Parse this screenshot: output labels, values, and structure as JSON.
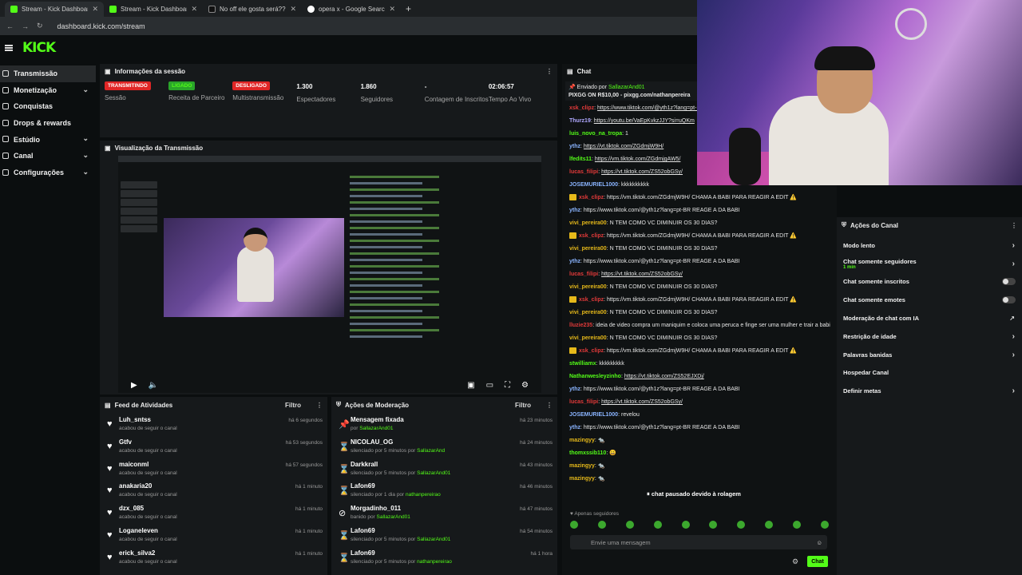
{
  "browser": {
    "tabs": [
      {
        "label": "Stream - Kick Dashboard",
        "active": true
      },
      {
        "label": "Stream - Kick Dashboard",
        "active": false
      },
      {
        "label": "No off ele gosta será?? 😂😂 |",
        "active": false
      },
      {
        "label": "opera x - Google Search",
        "active": false
      }
    ],
    "url": "dashboard.kick.com/stream"
  },
  "app": {
    "logo": "KICK"
  },
  "sidebar": {
    "items": [
      {
        "label": "Transmissão",
        "active": true
      },
      {
        "label": "Monetização"
      },
      {
        "label": "Conquistas"
      },
      {
        "label": "Drops & rewards"
      },
      {
        "label": "Estúdio"
      },
      {
        "label": "Canal"
      },
      {
        "label": "Configurações"
      }
    ]
  },
  "session": {
    "title": "Informações da sessão",
    "stats": [
      {
        "badge": "TRANSMITINDO",
        "label": "Sessão"
      },
      {
        "badge": "LIGADO",
        "label": "Receita de Parceiro"
      },
      {
        "badge": "DESLIGADO",
        "label": "Multistransmissão"
      },
      {
        "value": "1.300",
        "label": "Espectadores"
      },
      {
        "value": "1.860",
        "label": "Seguidores"
      },
      {
        "value": "-",
        "label": "Contagem de Inscritos"
      },
      {
        "value": "02:06:57",
        "label": "Tempo Ao Vivo"
      }
    ]
  },
  "preview": {
    "title": "Visualização da Transmissão"
  },
  "feed": {
    "title": "Feed de Atividades",
    "filter": "Filtro",
    "items": [
      {
        "name": "Luh_sntss",
        "action": "acabou de seguir o canal",
        "time": "há 6 segundos"
      },
      {
        "name": "Gtfv",
        "action": "acabou de seguir o canal",
        "time": "há 53 segundos"
      },
      {
        "name": "maiconml",
        "action": "acabou de seguir o canal",
        "time": "há 57 segundos"
      },
      {
        "name": "anakaria20",
        "action": "acabou de seguir o canal",
        "time": "há 1 minuto"
      },
      {
        "name": "dzx_085",
        "action": "acabou de seguir o canal",
        "time": "há 1 minuto"
      },
      {
        "name": "Loganeleven",
        "action": "acabou de seguir o canal",
        "time": "há 1 minuto"
      },
      {
        "name": "erick_silva2",
        "action": "acabou de seguir o canal",
        "time": "há 1 minuto"
      }
    ]
  },
  "moderation": {
    "title": "Ações de Moderação",
    "filter": "Filtro",
    "items": [
      {
        "name": "Mensagem fixada",
        "prefix": "por",
        "by": "SallazarAnd01",
        "time": "há 23 minutos"
      },
      {
        "name": "NICOLAU_OG",
        "prefix": "silenciado por 5 minutos por",
        "by": "SallazarAnd",
        "time": "há 24 minutos"
      },
      {
        "name": "Darkkrall",
        "prefix": "silenciado por 5 minutos por",
        "by": "SallazarAnd01",
        "time": "há 43 minutos"
      },
      {
        "name": "Lafon69",
        "prefix": "silenciado por 1 dia por",
        "by": "nathanpereirao",
        "time": "há 46 minutos"
      },
      {
        "name": "Morgadinho_011",
        "prefix": "banido por",
        "by": "SallazarAnd01",
        "time": "há 47 minutos"
      },
      {
        "name": "Lafon69",
        "prefix": "silenciado por 5 minutos por",
        "by": "SallazarAnd01",
        "time": "há 54 minutos"
      },
      {
        "name": "Lafon69",
        "prefix": "silenciado por 5 minutos por",
        "by": "nathanpereirao",
        "time": "há 1 hora"
      }
    ]
  },
  "chat": {
    "title": "Chat",
    "pinned_by_label": "Enviado por",
    "pinned_by": "SallazarAnd01",
    "pinned_text": "PIXGG ON R$10,00 - pixgg.com/nathanpereira",
    "messages": [
      {
        "user": "xsk_clipz",
        "color": "#e23a3a",
        "text": "https://www.tiktok.com/@yth1z?lang=pt-BR",
        "link": true
      },
      {
        "user": "Thurz19",
        "color": "#b0a8ff",
        "text": "https://youtu.be/VaEpKvkzJJY?si=uQKm",
        "link": true
      },
      {
        "user": "luis_novo_na_tropa",
        "color": "#53fc18",
        "text": "1"
      },
      {
        "user": "ythz",
        "color": "#8ab4ff",
        "text": "https://vt.tiktok.com/ZGdmjW9H/",
        "link": true
      },
      {
        "user": "lfedits11",
        "color": "#53fc18",
        "text": "https://vm.tiktok.com/ZGdmjgAW5/",
        "link": true
      },
      {
        "user": "lucas_filipi",
        "color": "#e23a3a",
        "text": "https://vt.tiktok.com/ZS52obGSy/",
        "link": true
      },
      {
        "user": "JOSEMURIEL1000",
        "color": "#8ab4ff",
        "text": "kkkkkkkkkk"
      },
      {
        "user": "xsk_clipz",
        "color": "#e23a3a",
        "text": "https://vm.tiktok.com/ZGdmjW9H/ CHAMA A BABI PARA REAGIR A EDIT ⚠️",
        "crown": true
      },
      {
        "user": "ythz",
        "color": "#8ab4ff",
        "text": "https://www.tiktok.com/@yth1z?lang=pt-BR REAGE A DA BABI"
      },
      {
        "user": "vivi_pereira00",
        "color": "#e6b91a",
        "text": "N TEM COMO VC DIMINUIR OS 30 DIAS?"
      },
      {
        "user": "xsk_clipz",
        "color": "#e23a3a",
        "text": "https://vm.tiktok.com/ZGdmjW9H/ CHAMA A BABI PARA REAGIR A EDIT ⚠️",
        "crown": true
      },
      {
        "user": "vivi_pereira00",
        "color": "#e6b91a",
        "text": "N TEM COMO VC DIMINUIR OS 30 DIAS?"
      },
      {
        "user": "ythz",
        "color": "#8ab4ff",
        "text": "https://www.tiktok.com/@yth1z?lang=pt-BR REAGE A DA BABI"
      },
      {
        "user": "lucas_filipi",
        "color": "#e23a3a",
        "text": "https://vt.tiktok.com/ZS52obGSy/",
        "link": true
      },
      {
        "user": "vivi_pereira00",
        "color": "#e6b91a",
        "text": "N TEM COMO VC DIMINUIR OS 30 DIAS?"
      },
      {
        "user": "xsk_clipz",
        "color": "#e23a3a",
        "text": "https://vm.tiktok.com/ZGdmjW9H/ CHAMA A BABI PARA REAGIR A EDIT ⚠️",
        "crown": true
      },
      {
        "user": "vivi_pereira00",
        "color": "#e6b91a",
        "text": "N TEM COMO VC DIMINUIR OS 30 DIAS?"
      },
      {
        "user": "lluzie235",
        "color": "#e23a3a",
        "text": "ideia de video compra um maniquim e coloca uma peruca e finge ser uma mulher e trair a babi"
      },
      {
        "user": "vivi_pereira00",
        "color": "#e6b91a",
        "text": "N TEM COMO VC DIMINUIR OS 30 DIAS?"
      },
      {
        "user": "xsk_clipz",
        "color": "#e23a3a",
        "text": "https://vm.tiktok.com/ZGdmjW9H/ CHAMA A BABI PARA REAGIR A EDIT ⚠️",
        "crown": true
      },
      {
        "user": "stwilliamx",
        "color": "#53fc18",
        "text": "kkkkkkkkk"
      },
      {
        "user": "Nathanwesleyzinho",
        "color": "#53fc18",
        "text": "https://vt.tiktok.com/ZS52EJXDj/",
        "link": true
      },
      {
        "user": "ythz",
        "color": "#8ab4ff",
        "text": "https://www.tiktok.com/@yth1z?lang=pt-BR REAGE A DA BABI"
      },
      {
        "user": "lucas_filipi",
        "color": "#e23a3a",
        "text": "https://vt.tiktok.com/ZS52obGSy/",
        "link": true
      },
      {
        "user": "JOSEMURIEL1000",
        "color": "#8ab4ff",
        "text": "revelou"
      },
      {
        "user": "ythz",
        "color": "#8ab4ff",
        "text": "https://www.tiktok.com/@yth1z?lang=pt-BR REAGE A DA BABI"
      },
      {
        "user": "mazingyy",
        "color": "#e6b91a",
        "text": "🐀"
      },
      {
        "user": "thomxssib110",
        "color": "#53fc18",
        "text": "😀"
      },
      {
        "user": "mazingyy",
        "color": "#e6b91a",
        "text": "🐀"
      },
      {
        "user": "mazingyy",
        "color": "#e6b91a",
        "text": "🐀"
      }
    ],
    "paused_notice": "chat pausado devido à rolagem",
    "followers_only": "Apenas seguidores",
    "input_placeholder": "Envie uma mensagem",
    "send_label": "Chat"
  },
  "channel_actions": {
    "title": "Ações do Canal",
    "items": [
      {
        "label": "Modo lento",
        "type": "chevron"
      },
      {
        "label": "Chat somente seguidores",
        "sub": "1 min",
        "type": "chevron"
      },
      {
        "label": "Chat somente inscritos",
        "type": "toggle"
      },
      {
        "label": "Chat somente emotes",
        "type": "toggle"
      },
      {
        "label": "Moderação de chat com IA",
        "type": "link"
      },
      {
        "label": "Restrição de idade",
        "type": "chevron"
      },
      {
        "label": "Palavras banidas",
        "type": "chevron"
      },
      {
        "label": "Hospedar Canal",
        "type": "none"
      },
      {
        "label": "Definir metas",
        "type": "chevron"
      }
    ]
  }
}
